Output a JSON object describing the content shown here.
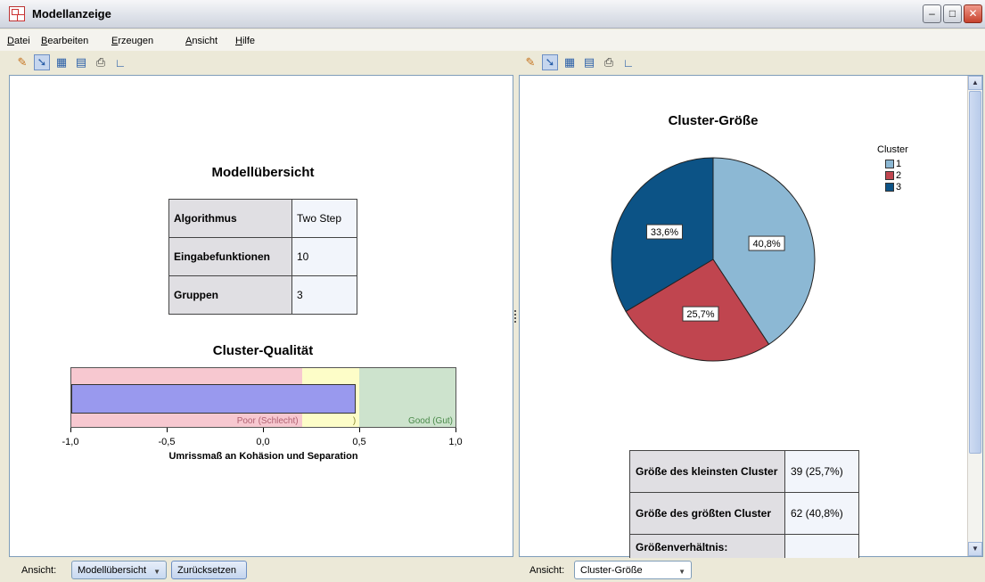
{
  "window": {
    "title": "Modellanzeige"
  },
  "menu": [
    "Datei",
    "Bearbeiten",
    "Erzeugen",
    "Ansicht",
    "Hilfe"
  ],
  "toolbar_icons": [
    "brush-icon",
    "pointer-icon",
    "copy-chart-icon",
    "copy-table-icon",
    "print-icon",
    "axis-icon"
  ],
  "left": {
    "summary_title": "Modellübersicht",
    "summary_rows": [
      {
        "label": "Algorithmus",
        "value": "Two Step"
      },
      {
        "label": "Eingabefunktionen",
        "value": "10"
      },
      {
        "label": "Gruppen",
        "value": "3"
      }
    ],
    "quality": {
      "title": "Cluster-Qualität",
      "zones": [
        {
          "label": "Poor (Schlecht)",
          "from": -1.0,
          "to": 0.2,
          "color": "#f7c8d0"
        },
        {
          "label": ")",
          "from": 0.2,
          "to": 0.5,
          "color": "#fdfdc8"
        },
        {
          "label": "Good (Gut)",
          "from": 0.5,
          "to": 1.0,
          "color": "#cde3cd"
        }
      ],
      "value": 0.48,
      "xticks": [
        "-1,0",
        "-0,5",
        "0,0",
        "0,5",
        "1,0"
      ],
      "xlabel": "Umrissmaß an Kohäsion und Separation"
    },
    "bottom": {
      "view_label": "Ansicht:",
      "view_value": "Modellübersicht",
      "reset_label": "Zurücksetzen"
    }
  },
  "right": {
    "chart_data": {
      "type": "pie",
      "title": "Cluster-Größe",
      "legend_title": "Cluster",
      "categories": [
        "1",
        "2",
        "3"
      ],
      "values": [
        40.8,
        25.7,
        33.6
      ],
      "labels": [
        "40,8%",
        "25,7%",
        "33,6%"
      ],
      "colors": [
        "#8cb8d4",
        "#c0454f",
        "#0c5386"
      ],
      "legend_position": "top-right"
    },
    "size_rows": [
      {
        "label": "Größe des kleinsten Cluster",
        "value": "39 (25,7%)"
      },
      {
        "label": "Größe des größten Cluster",
        "value": "62 (40,8%)"
      },
      {
        "label": "Größenverhältnis:",
        "value": ""
      }
    ],
    "bottom": {
      "view_label": "Ansicht:",
      "view_value": "Cluster-Größe"
    }
  }
}
